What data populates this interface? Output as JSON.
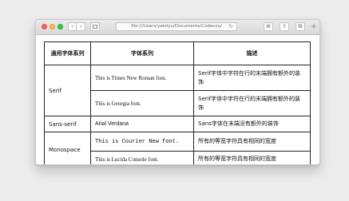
{
  "browser": {
    "address": "file:///Users/yatsiyu/Documents/Codecou/",
    "back_glyph": "‹",
    "forward_glyph": "›",
    "reload_glyph": "↻",
    "download_glyph": "⊕",
    "share_glyph": "⇧",
    "tabs_glyph": "⧉",
    "add_tab_glyph": "+"
  },
  "table": {
    "headers": [
      "通用字体系列",
      "字体系列",
      "描述"
    ],
    "groups": {
      "serif": "Serif",
      "sans_serif": "Sans-serif",
      "monospace": "Monospace"
    },
    "rows": [
      {
        "font": "This is Times New Roman font.",
        "desc": "Serif字体中字符在行的末端拥有额外的装饰"
      },
      {
        "font": "This is Georgia font.",
        "desc": "Serif字体中字符在行的末端拥有额外的装饰"
      },
      {
        "font": "Arial Verdana",
        "desc": "Sans字体在末端没有额外的装饰"
      },
      {
        "font": "This is Courier New font.",
        "desc": "所有的等宽字符具有相同的宽度"
      },
      {
        "font": "This is Lucida Console font.",
        "desc": "所有的等宽字符具有相同的宽度"
      }
    ]
  }
}
